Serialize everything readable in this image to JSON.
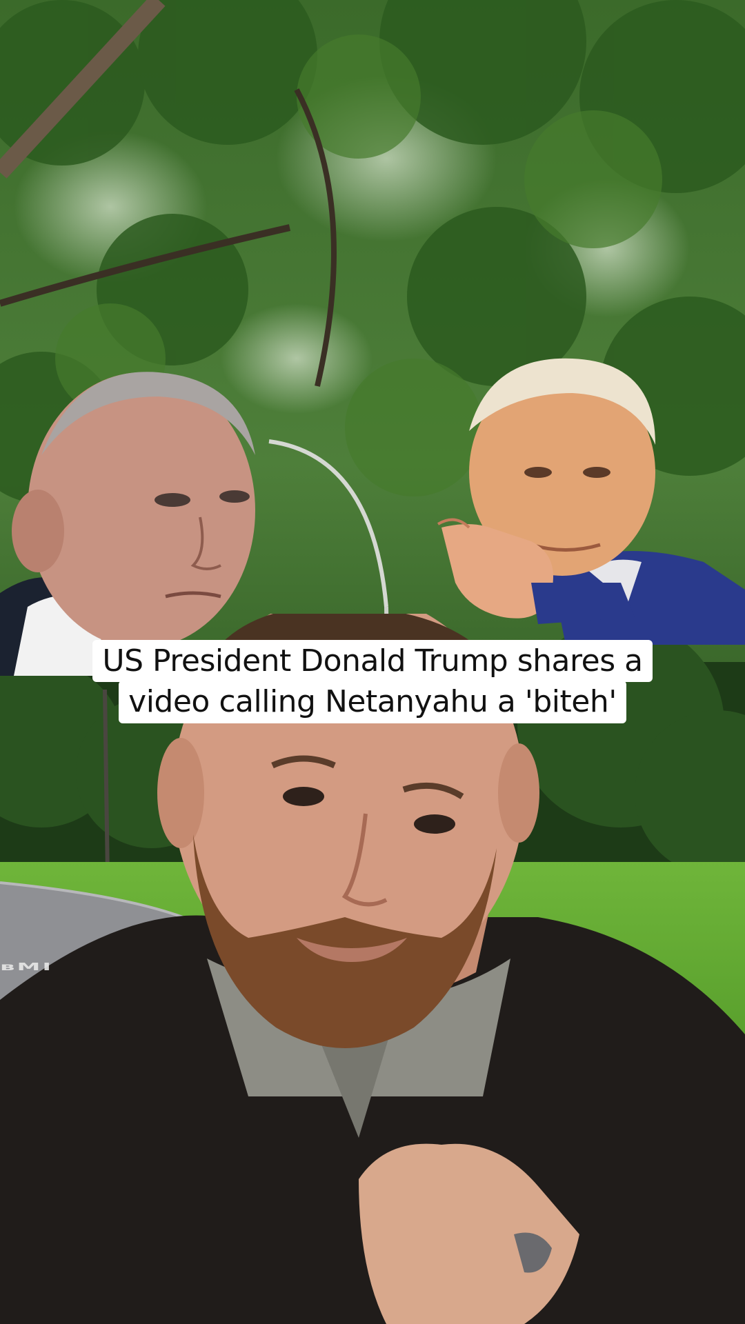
{
  "caption": {
    "line1": "US President Donald Trump shares a",
    "line2": "video calling Netanyahu a 'biteh'"
  },
  "road_marking": "вMI",
  "colors": {
    "caption_bg": "#ffffff",
    "caption_text": "#111111",
    "foliage": "#2f5a22",
    "grass": "#5ea52e",
    "road": "#8f9094"
  }
}
